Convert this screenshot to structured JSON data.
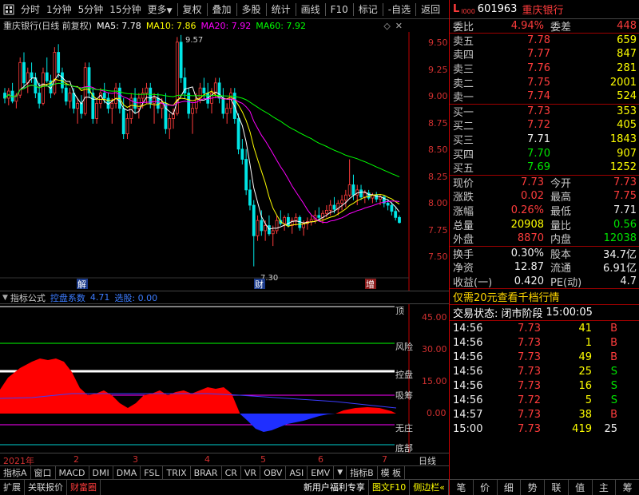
{
  "toolbar": {
    "items": [
      "分时",
      "1分钟",
      "5分钟",
      "15分钟",
      "更多",
      "复权",
      "叠加",
      "多股",
      "统计",
      "画线",
      "F10",
      "标记",
      "-自选",
      "返回"
    ]
  },
  "main_title": {
    "name": "重庆银行(日线 前复权)",
    "ma5": "MA5: 7.78",
    "ma10": "MA10: 7.86",
    "ma20": "MA20: 7.92",
    "ma60": "MA60: 7.92"
  },
  "price_axis": [
    "9.50",
    "9.25",
    "9.00",
    "8.75",
    "8.50",
    "8.25",
    "8.00",
    "7.75",
    "7.50"
  ],
  "annotations": {
    "high": "9.57",
    "low": "7.30",
    "mark1": "解",
    "mark2": "财",
    "mark3": "增"
  },
  "indicator_title": {
    "label": "指标公式",
    "name": "控盘系数",
    "value": "4.71",
    "select": "选股: 0.00"
  },
  "ind_axis": [
    "45.00",
    "30.00",
    "15.00",
    "0.00"
  ],
  "ind_lines": [
    "顶",
    "风险",
    "控盘",
    "吸筹",
    "无庄",
    "底部"
  ],
  "time_axis": {
    "year": "2021年",
    "months": [
      "2",
      "3",
      "4",
      "5",
      "6",
      "7"
    ],
    "unit": "日线"
  },
  "bottom_tabs": [
    "指标A",
    "窗口",
    "MACD",
    "DMI",
    "DMA",
    "FSL",
    "TRIX",
    "BRAR",
    "CR",
    "VR",
    "OBV",
    "ASI",
    "EMV",
    "指标B",
    "模 板"
  ],
  "bottom_bar": [
    "扩展",
    "关联报价",
    "财富圈",
    "新用户福利专享",
    "图文F10",
    "侧边栏«"
  ],
  "stock": {
    "prefix": "L",
    "level": "l000",
    "code": "601963",
    "name": "重庆银行"
  },
  "weibi": {
    "label": "委比",
    "value": "4.94%",
    "label2": "委差",
    "value2": "448"
  },
  "asks": [
    {
      "label": "卖五",
      "price": "7.78",
      "vol": "659"
    },
    {
      "label": "卖四",
      "price": "7.77",
      "vol": "847"
    },
    {
      "label": "卖三",
      "price": "7.76",
      "vol": "281"
    },
    {
      "label": "卖二",
      "price": "7.75",
      "vol": "2001"
    },
    {
      "label": "卖一",
      "price": "7.74",
      "vol": "524"
    }
  ],
  "bids": [
    {
      "label": "买一",
      "price": "7.73",
      "vol": "353"
    },
    {
      "label": "买二",
      "price": "7.72",
      "vol": "405"
    },
    {
      "label": "买三",
      "price": "7.71",
      "vol": "1843"
    },
    {
      "label": "买四",
      "price": "7.70",
      "vol": "907"
    },
    {
      "label": "买五",
      "price": "7.69",
      "vol": "1252"
    }
  ],
  "quote": [
    {
      "l1": "现价",
      "v1": "7.73",
      "c1": "red",
      "l2": "今开",
      "v2": "7.73",
      "c2": "red"
    },
    {
      "l1": "涨跌",
      "v1": "0.02",
      "c1": "red",
      "l2": "最高",
      "v2": "7.75",
      "c2": "red"
    },
    {
      "l1": "涨幅",
      "v1": "0.26%",
      "c1": "red",
      "l2": "最低",
      "v2": "7.71",
      "c2": "white"
    },
    {
      "l1": "总量",
      "v1": "20908",
      "c1": "yellow",
      "l2": "量比",
      "v2": "0.56",
      "c2": "green"
    },
    {
      "l1": "外盘",
      "v1": "8870",
      "c1": "red",
      "l2": "内盘",
      "v2": "12038",
      "c2": "green"
    }
  ],
  "finance": [
    {
      "l1": "换手",
      "v1": "0.30%",
      "l2": "股本",
      "v2": "34.7亿"
    },
    {
      "l1": "净资",
      "v1": "12.87",
      "l2": "流通",
      "v2": "6.91亿"
    },
    {
      "l1": "收益(一)",
      "v1": "0.420",
      "l2": "PE(动)",
      "v2": "4.7"
    }
  ],
  "promo": "仅需20元查看千档行情",
  "trade_status": {
    "label": "交易状态: 闭市阶段",
    "time": "15:00:05"
  },
  "ticks": [
    {
      "time": "14:56",
      "price": "7.73",
      "vol": "41",
      "bs": "B"
    },
    {
      "time": "14:56",
      "price": "7.73",
      "vol": "1",
      "bs": "B"
    },
    {
      "time": "14:56",
      "price": "7.73",
      "vol": "49",
      "bs": "B"
    },
    {
      "time": "14:56",
      "price": "7.73",
      "vol": "25",
      "bs": "S"
    },
    {
      "time": "14:56",
      "price": "7.73",
      "vol": "16",
      "bs": "S"
    },
    {
      "time": "14:56",
      "price": "7.72",
      "vol": "5",
      "bs": "S"
    },
    {
      "time": "14:57",
      "price": "7.73",
      "vol": "38",
      "bs": "B"
    },
    {
      "time": "15:00",
      "price": "7.73",
      "vol": "419",
      "bs": "25"
    }
  ],
  "right_tabs": [
    "笔",
    "价",
    "细",
    "势",
    "联",
    "值",
    "主",
    "筹"
  ],
  "colors": {
    "up": "#ff3c3c",
    "down": "#00e6e6",
    "ma5": "#ffffff",
    "ma10": "#ffff00",
    "ma20": "#ff00ff",
    "ma60": "#00ff00",
    "axis": "#c00000"
  },
  "chart_data": {
    "type": "candlestick",
    "ylim": [
      7.25,
      9.6
    ],
    "yticks": [
      9.5,
      9.25,
      9.0,
      8.75,
      8.5,
      8.25,
      8.0,
      7.75,
      7.5
    ],
    "candles": [
      [
        9.0,
        9.05,
        8.9,
        8.95
      ],
      [
        8.95,
        9.05,
        8.88,
        9.02
      ],
      [
        9.02,
        9.1,
        8.9,
        8.92
      ],
      [
        8.92,
        9.0,
        8.85,
        8.98
      ],
      [
        8.98,
        9.35,
        8.95,
        9.3
      ],
      [
        9.3,
        9.4,
        9.05,
        9.1
      ],
      [
        9.1,
        9.25,
        9.0,
        9.2
      ],
      [
        9.2,
        9.3,
        9.1,
        9.15
      ],
      [
        9.15,
        9.2,
        8.95,
        9.0
      ],
      [
        9.0,
        9.1,
        8.85,
        8.9
      ],
      [
        8.9,
        9.25,
        8.88,
        9.2
      ],
      [
        9.2,
        9.35,
        9.1,
        9.12
      ],
      [
        9.12,
        9.18,
        8.95,
        9.0
      ],
      [
        9.0,
        9.45,
        8.98,
        9.4
      ],
      [
        9.4,
        9.48,
        9.15,
        9.2
      ],
      [
        9.2,
        9.25,
        9.0,
        9.05
      ],
      [
        9.05,
        9.1,
        8.88,
        8.92
      ],
      [
        8.92,
        9.05,
        8.85,
        9.0
      ],
      [
        9.0,
        9.05,
        8.8,
        8.85
      ],
      [
        8.85,
        8.95,
        8.7,
        8.9
      ],
      [
        8.9,
        8.98,
        8.75,
        8.8
      ],
      [
        8.8,
        9.3,
        8.78,
        9.25
      ],
      [
        9.25,
        9.3,
        8.95,
        9.0
      ],
      [
        9.0,
        9.05,
        8.7,
        8.75
      ],
      [
        8.75,
        8.95,
        8.7,
        8.9
      ],
      [
        8.9,
        9.05,
        8.85,
        9.0
      ],
      [
        9.0,
        9.1,
        8.9,
        8.95
      ],
      [
        8.95,
        9.0,
        8.8,
        8.85
      ],
      [
        8.85,
        8.95,
        8.7,
        8.9
      ],
      [
        8.9,
        9.1,
        8.85,
        9.05
      ],
      [
        9.05,
        9.1,
        8.8,
        8.85
      ],
      [
        8.85,
        8.95,
        8.55,
        8.6
      ],
      [
        8.6,
        8.8,
        8.55,
        8.75
      ],
      [
        8.75,
        9.0,
        8.7,
        8.95
      ],
      [
        8.95,
        9.05,
        8.8,
        8.85
      ],
      [
        8.85,
        9.0,
        8.75,
        8.95
      ],
      [
        8.95,
        9.05,
        8.85,
        9.0
      ],
      [
        9.0,
        9.1,
        8.9,
        9.05
      ],
      [
        9.05,
        9.1,
        8.85,
        8.9
      ],
      [
        8.9,
        9.0,
        8.7,
        8.95
      ],
      [
        8.95,
        9.0,
        8.8,
        8.85
      ],
      [
        8.85,
        8.95,
        8.75,
        8.9
      ],
      [
        8.9,
        9.0,
        8.6,
        8.65
      ],
      [
        8.65,
        8.8,
        8.55,
        8.75
      ],
      [
        8.75,
        8.85,
        8.65,
        8.8
      ],
      [
        8.8,
        9.55,
        8.78,
        9.5
      ],
      [
        9.5,
        9.57,
        9.1,
        9.15
      ],
      [
        9.15,
        9.25,
        8.95,
        9.0
      ],
      [
        9.0,
        9.05,
        8.75,
        8.8
      ],
      [
        8.8,
        8.9,
        8.6,
        8.85
      ],
      [
        8.85,
        9.0,
        8.8,
        8.95
      ],
      [
        8.95,
        9.1,
        8.9,
        9.05
      ],
      [
        9.05,
        9.15,
        8.95,
        9.0
      ],
      [
        9.0,
        9.1,
        8.85,
        8.9
      ],
      [
        8.9,
        9.05,
        8.8,
        9.0
      ],
      [
        9.0,
        9.15,
        8.95,
        9.1
      ],
      [
        9.1,
        9.15,
        8.9,
        8.95
      ],
      [
        8.95,
        9.05,
        8.75,
        8.8
      ],
      [
        8.8,
        8.9,
        8.7,
        8.85
      ],
      [
        8.85,
        9.05,
        8.8,
        9.0
      ],
      [
        9.0,
        9.05,
        8.7,
        8.75
      ],
      [
        8.75,
        8.8,
        8.4,
        8.45
      ],
      [
        8.45,
        8.55,
        8.3,
        8.35
      ],
      [
        8.35,
        8.45,
        8.0,
        8.05
      ],
      [
        8.05,
        8.15,
        7.85,
        7.9
      ],
      [
        7.9,
        7.95,
        7.3,
        7.6
      ],
      [
        7.6,
        7.8,
        7.55,
        7.75
      ],
      [
        7.75,
        7.85,
        7.6,
        7.65
      ],
      [
        7.65,
        7.75,
        7.55,
        7.7
      ],
      [
        7.7,
        7.8,
        7.6,
        7.62
      ],
      [
        7.62,
        7.7,
        7.5,
        7.65
      ],
      [
        7.65,
        7.8,
        7.62,
        7.75
      ],
      [
        7.75,
        7.85,
        7.7,
        7.72
      ],
      [
        7.72,
        7.8,
        7.65,
        7.78
      ],
      [
        7.78,
        7.82,
        7.68,
        7.7
      ],
      [
        7.7,
        7.78,
        7.62,
        7.75
      ],
      [
        7.75,
        7.82,
        7.7,
        7.78
      ],
      [
        7.78,
        7.8,
        7.65,
        7.68
      ],
      [
        7.68,
        7.75,
        7.6,
        7.72
      ],
      [
        7.72,
        7.78,
        7.66,
        7.74
      ],
      [
        7.74,
        7.8,
        7.7,
        7.76
      ],
      [
        7.76,
        7.85,
        7.72,
        7.8
      ],
      [
        7.8,
        7.88,
        7.74,
        7.78
      ],
      [
        7.78,
        7.85,
        7.72,
        7.82
      ],
      [
        7.82,
        7.9,
        7.78,
        7.85
      ],
      [
        7.85,
        7.95,
        7.8,
        7.9
      ],
      [
        7.9,
        7.98,
        7.82,
        7.86
      ],
      [
        7.86,
        7.95,
        7.8,
        7.92
      ],
      [
        7.92,
        8.0,
        7.85,
        7.95
      ],
      [
        7.95,
        8.05,
        7.88,
        8.0
      ],
      [
        8.0,
        8.35,
        7.98,
        8.1
      ],
      [
        8.1,
        8.2,
        7.95,
        8.0
      ],
      [
        8.0,
        8.1,
        7.9,
        8.05
      ],
      [
        8.05,
        8.1,
        7.95,
        7.98
      ],
      [
        7.98,
        8.05,
        7.92,
        8.02
      ],
      [
        8.02,
        8.05,
        7.95,
        7.97
      ],
      [
        7.97,
        8.02,
        7.92,
        8.0
      ],
      [
        8.0,
        8.03,
        7.93,
        7.96
      ],
      [
        7.96,
        8.0,
        7.9,
        7.98
      ],
      [
        7.98,
        8.0,
        7.88,
        7.92
      ],
      [
        7.92,
        7.96,
        7.85,
        7.9
      ],
      [
        7.9,
        7.93,
        7.8,
        7.84
      ],
      [
        7.84,
        7.88,
        7.75,
        7.78
      ],
      [
        7.78,
        7.8,
        7.72,
        7.73
      ]
    ]
  }
}
